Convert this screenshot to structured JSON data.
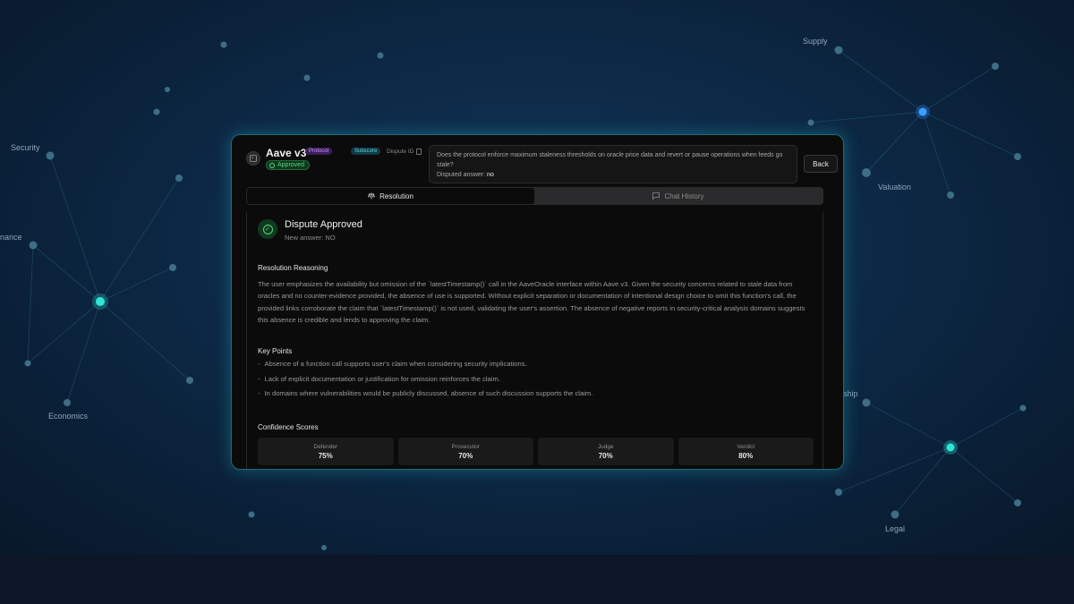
{
  "background": {
    "labels": [
      "Supply",
      "Security",
      "Valuation",
      "nance",
      "ship",
      "Economics",
      "Legal"
    ],
    "accent_color": "#2ee6d6"
  },
  "header": {
    "project_title": "Aave v3",
    "badge_protocol": "Protocol",
    "badge_subscore": "Subscore",
    "dispute_id_label": "Dispute ID",
    "status_badge": "Approved",
    "question": "Does the protocol enforce maximum staleness thresholds on oracle price data and revert or pause operations when feeds go stale?",
    "disputed_answer_label": "Disputed answer:",
    "disputed_answer_value": "no",
    "back_label": "Back"
  },
  "tabs": {
    "resolution": "Resolution",
    "chat_history": "Chat History"
  },
  "resolution": {
    "title": "Dispute Approved",
    "new_answer": "New answer: NO",
    "reasoning_title": "Resolution Reasoning",
    "reasoning_text": "The user emphasizes the availability but omission of the `latestTimestamp()` call in the AaveOracle interface within Aave v3. Given the security concerns related to stale data from oracles and no counter-evidence provided, the absence of use is supported. Without explicit separation or documentation of intentional design choice to omit this function's call, the provided links corroborate the claim that `latestTimestamp()` is not used, validating the user's assertion. The absence of negative reports in security-critical analysis domains suggests this absence is credible and lends to approving the claim.",
    "key_points_title": "Key Points",
    "key_points": [
      "Absence of a function call supports user's claim when considering security implications.",
      "Lack of explicit documentation or justification for omission reinforces the claim.",
      "In domains where vulnerabilities would be publicly discussed, absence of such discussion supports the claim."
    ],
    "confidence_title": "Confidence Scores",
    "scores": [
      {
        "label": "Defender",
        "value": "75%"
      },
      {
        "label": "Prosecutor",
        "value": "70%"
      },
      {
        "label": "Judge",
        "value": "70%"
      },
      {
        "label": "Verdict",
        "value": "80%"
      }
    ]
  }
}
